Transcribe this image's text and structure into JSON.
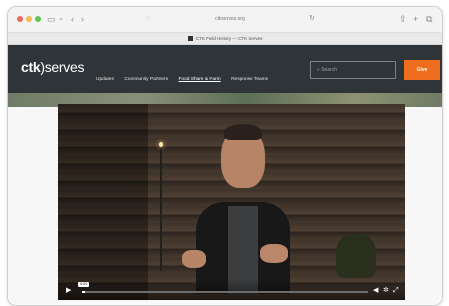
{
  "browser": {
    "address": "ctkserves.org",
    "tab_title": "CTK Field History — CTK Serves",
    "icons": [
      "sidebar-icon",
      "chevron-down-icon",
      "back-icon",
      "forward-icon",
      "shield-icon",
      "reload-icon",
      "share-icon",
      "new-tab-icon",
      "tabs-icon"
    ]
  },
  "site": {
    "logo_left": "ctk",
    "logo_right": ")serves",
    "nav": [
      "Updates",
      "Community Partners",
      "Food Share & Farm",
      "Response Teams"
    ],
    "nav_active": "Food Share & Farm",
    "search_placeholder": "Search",
    "give_label": "Give"
  },
  "video": {
    "time_tooltip": "0:00",
    "progress": 0.01,
    "icons": [
      "play-icon",
      "volume-icon",
      "settings-icon",
      "fullscreen-icon"
    ]
  },
  "colors": {
    "header_bg": "#2e3438",
    "give_button": "#ef6d1f"
  }
}
